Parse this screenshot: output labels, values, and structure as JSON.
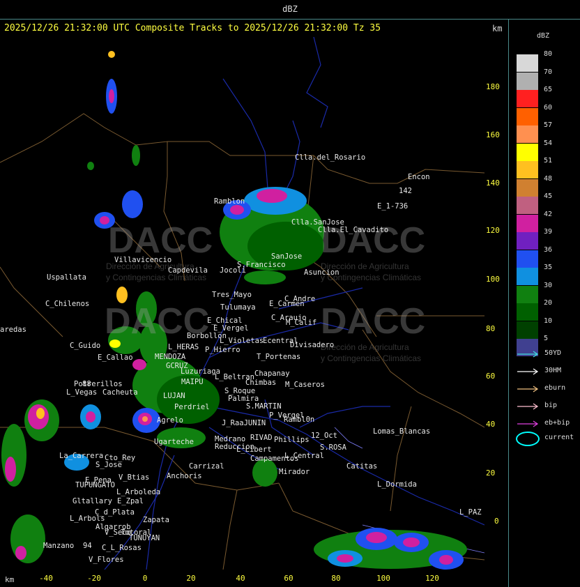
{
  "header": {
    "title": "dBZ",
    "subtitle": "2025/12/26 21:32:00 UTC Composite Tracks to 2025/12/26 21:32:00 Tz 35",
    "km_unit_top": "km",
    "km_unit_bottom": "km"
  },
  "axes": {
    "y_ticks": [
      "180",
      "160",
      "140",
      "120",
      "100",
      "80",
      "60",
      "40",
      "20",
      "0"
    ],
    "x_ticks": [
      "-40",
      "-20",
      "0",
      "20",
      "40",
      "60",
      "80",
      "100",
      "120"
    ]
  },
  "legend": {
    "title": "dBZ",
    "levels": [
      {
        "label": "80",
        "color": "#d8d8d8"
      },
      {
        "label": "70",
        "color": "#b0b0b0"
      },
      {
        "label": "65",
        "color": "#ff2020"
      },
      {
        "label": "60",
        "color": "#ff6000"
      },
      {
        "label": "57",
        "color": "#ff9050"
      },
      {
        "label": "54",
        "color": "#ffff00"
      },
      {
        "label": "51",
        "color": "#ffc020"
      },
      {
        "label": "48",
        "color": "#d08030"
      },
      {
        "label": "45",
        "color": "#c06080"
      },
      {
        "label": "42",
        "color": "#d020a0"
      },
      {
        "label": "39",
        "color": "#7020c0"
      },
      {
        "label": "36",
        "color": "#2050f0"
      },
      {
        "label": "35",
        "color": "#1090e0"
      },
      {
        "label": "30",
        "color": "#108010"
      },
      {
        "label": "20",
        "color": "#006000"
      },
      {
        "label": "10",
        "color": "#004000"
      },
      {
        "label": "5",
        "color": "#404090"
      }
    ],
    "tracks": [
      {
        "label": "50YD",
        "color": "#40e0e0"
      },
      {
        "label": "30HM",
        "color": "#ffffff"
      },
      {
        "label": "eburn",
        "color": "#f0c080"
      },
      {
        "label": "bip",
        "color": "#ffc0d0"
      },
      {
        "label": "eb+bip",
        "color": "#e040e0"
      }
    ],
    "current_label": "current"
  },
  "watermark": {
    "text": "DACC",
    "line1": "Dirección de Agricultura",
    "line2": "y Contingencias Climáticas"
  },
  "cities": [
    "Clla.del_Rosario",
    "Encon",
    "142",
    "E_1-736",
    "Ramblon",
    "Clla.SanJose",
    "Clla.El_Cavadito",
    "Villavicencio",
    "Capdevila",
    "Jocoli",
    "S.Francisco",
    "SanJose",
    "Asuncion",
    "Uspallata",
    "Tres_Mayo",
    "C_Andre",
    "Tulumaya",
    "E_Carmen",
    "C_Chilenos",
    "E_Chical",
    "C_Araujo",
    "M_Calif",
    "E_Vergel",
    "Borbollon",
    "Ecentral",
    "aredas",
    "Divisadero",
    "L_Violetas",
    "P_Hierro",
    "L_HERAS",
    "C_Guido",
    "T_Portenas",
    "E_Callao",
    "MENDOZA",
    "GCRUZ",
    "Luzuriaga",
    "Chapanay",
    "Potrerillos",
    "MAIPU",
    "L_Beltran",
    "Chimbas",
    "M_Caseros",
    "L_Vegas",
    "Cacheuta",
    "S_Roque",
    "LUJAN",
    "Palmira",
    "Perdriel",
    "S.MARTIN",
    "P_Vergel",
    "Agrelo",
    "Rambl0n",
    "J_RaaJUNIN",
    "Ugarteche",
    "Lomas_Blancas",
    "12_Oct",
    "RIVAD",
    "Phillips",
    "Medrano",
    "Reduccion",
    "S.ROSA",
    "L_Libert",
    "L_Central",
    "La_Carrera",
    "Cto_Rey",
    "Campamentos",
    "S_Jose",
    "Catitas",
    "E_Pena",
    "V_Btias",
    "Anchoris",
    "Carrizal",
    "Mirador",
    "TUPUNGATO",
    "L_Dormida",
    "L_Arboleda",
    "Gltallary",
    "E_Zpal",
    "C_d_Plata",
    "L_PAZ",
    "L_Arbols",
    "Zapata",
    "Algarrob",
    "V_Seco",
    "Totoral",
    "TUNUYAN",
    "Manzano",
    "C_L_Rosas",
    "94",
    "V_Flores",
    "88"
  ]
}
